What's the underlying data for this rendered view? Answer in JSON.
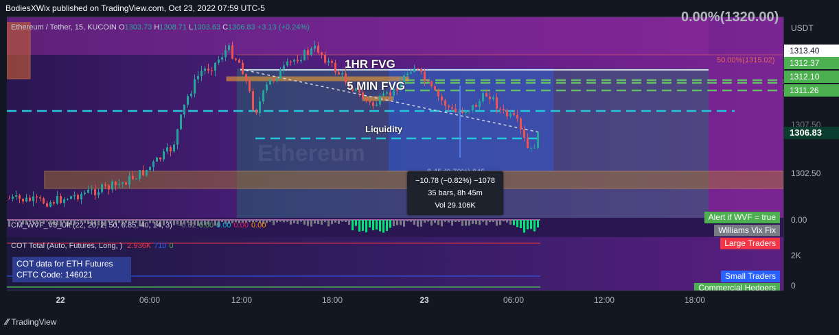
{
  "header": {
    "publisher": "BodiesXWix published on TradingView.com, Oct 23, 2022 07:59 UTC-5"
  },
  "symbol": {
    "name": "Ethereum / Tether, 15, KUCOIN",
    "open_label": "O",
    "open": "1303.73",
    "high_label": "H",
    "high": "1308.71",
    "low_label": "L",
    "low": "1303.63",
    "close_label": "C",
    "close": "1306.83",
    "change": "+3.13 (+0.24%)"
  },
  "price_axis": {
    "unit": "USDT",
    "ticks": [
      "0.00",
      "2K",
      "0"
    ],
    "mid_tick": "1302.50",
    "labels": [
      {
        "text": "1313.40",
        "bg": "#ffffff",
        "fg": "#131722"
      },
      {
        "text": "1312.37",
        "bg": "#4caf50",
        "fg": "#ffffff"
      },
      {
        "text": "1312.10",
        "bg": "#4caf50",
        "fg": "#ffffff"
      },
      {
        "text": "1311.26",
        "bg": "#4caf50",
        "fg": "#ffffff"
      },
      {
        "text": "1306.83",
        "bg": "#0b3d2e",
        "fg": "#ffffff"
      }
    ],
    "partial_tick": "1307.50"
  },
  "annotations": {
    "fvg_1hr": "1HR FVG",
    "fvg_5min": "5 MIN FVG",
    "liquidity": "Liquidity",
    "fib_label": "50.00%(1315.02)",
    "corner_text": "0.00%(1320.00)",
    "watermark": "Ethereum"
  },
  "measure": {
    "change": "−10.78 (−0.82%) −1078",
    "bars": "35 bars, 8h 45m",
    "vol": "Vol 29.106K",
    "behind": "8.45 (0.70%) 845"
  },
  "indicator_wvf": {
    "legend": "CM_WVF_V3_Ult (22, 20, 2, 50, 0.85, 40, 14, 3)",
    "values": [
      {
        "text": "−0.62",
        "color": "#787b86"
      },
      {
        "text": "0.00",
        "color": "#4caf50"
      },
      {
        "text": "0.00",
        "color": "#00bcd4"
      },
      {
        "text": "0.00",
        "color": "#e91e63"
      },
      {
        "text": "0.00",
        "color": "#ff9800"
      }
    ],
    "alert_tag": "Alert if WVF = true",
    "name_tag": "Williams Vix Fix"
  },
  "indicator_cot": {
    "legend": "COT Total (Auto, Futures, Long, )",
    "values": [
      {
        "text": "2.936K",
        "color": "#f23645"
      },
      {
        "text": "710",
        "color": "#2962ff"
      },
      {
        "text": "0",
        "color": "#4caf50"
      }
    ],
    "box_line1": "COT data for ETH Futures",
    "box_line2": "CFTC Code: 146021",
    "tags": [
      {
        "text": "Large Traders",
        "bg": "#f23645"
      },
      {
        "text": "Small Traders",
        "bg": "#2962ff"
      },
      {
        "text": "Commercial Hedgers",
        "bg": "#4caf50"
      }
    ]
  },
  "time_axis": [
    {
      "label": "22",
      "bold": true
    },
    {
      "label": "06:00"
    },
    {
      "label": "12:00"
    },
    {
      "label": "18:00"
    },
    {
      "label": "23",
      "bold": true
    },
    {
      "label": "06:00"
    },
    {
      "label": "12:00"
    },
    {
      "label": "18:00"
    }
  ],
  "footer": {
    "brand": "TradingView"
  },
  "colors": {
    "up": "#26a69a",
    "down": "#ef5350",
    "bg": "#131722",
    "fvg_box": "#f0a030",
    "cyan_dash": "#26c6da",
    "green_dash": "#66bb6a",
    "purple": "#7b1fa2"
  }
}
